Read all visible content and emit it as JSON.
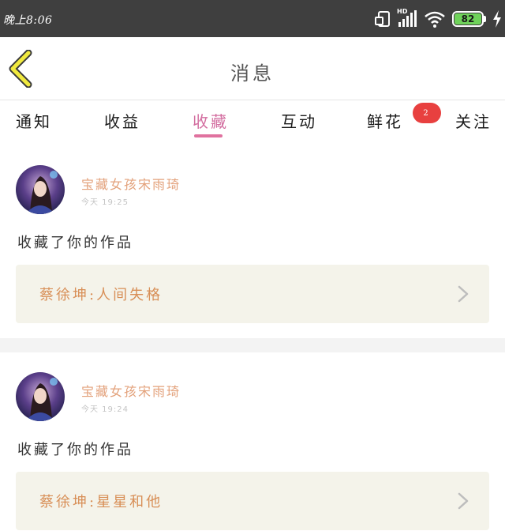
{
  "status_bar": {
    "time": "晚上8:06",
    "network_label": "HD",
    "battery": "82"
  },
  "header": {
    "title": "消息"
  },
  "tabs": [
    {
      "label": "通知"
    },
    {
      "label": "收益"
    },
    {
      "label": "收藏",
      "badge": "2"
    },
    {
      "label": "互动"
    },
    {
      "label": "鲜花"
    },
    {
      "label": "关注"
    }
  ],
  "messages": [
    {
      "sender": "宝藏女孩宋雨琦",
      "time": "今天 19:25",
      "action": "收藏了你的作品",
      "work": "蔡徐坤:人间失格"
    },
    {
      "sender": "宝藏女孩宋雨琦",
      "time": "今天 19:24",
      "action": "收藏了你的作品",
      "work": "蔡徐坤:星星和他"
    }
  ],
  "colors": {
    "accent": "#e0729f",
    "badge": "#e8403f",
    "sender": "#e3a27c",
    "work_title": "#d88f57",
    "card_bg": "#f4f3ea",
    "back_arrow": "#f1ea3f"
  }
}
